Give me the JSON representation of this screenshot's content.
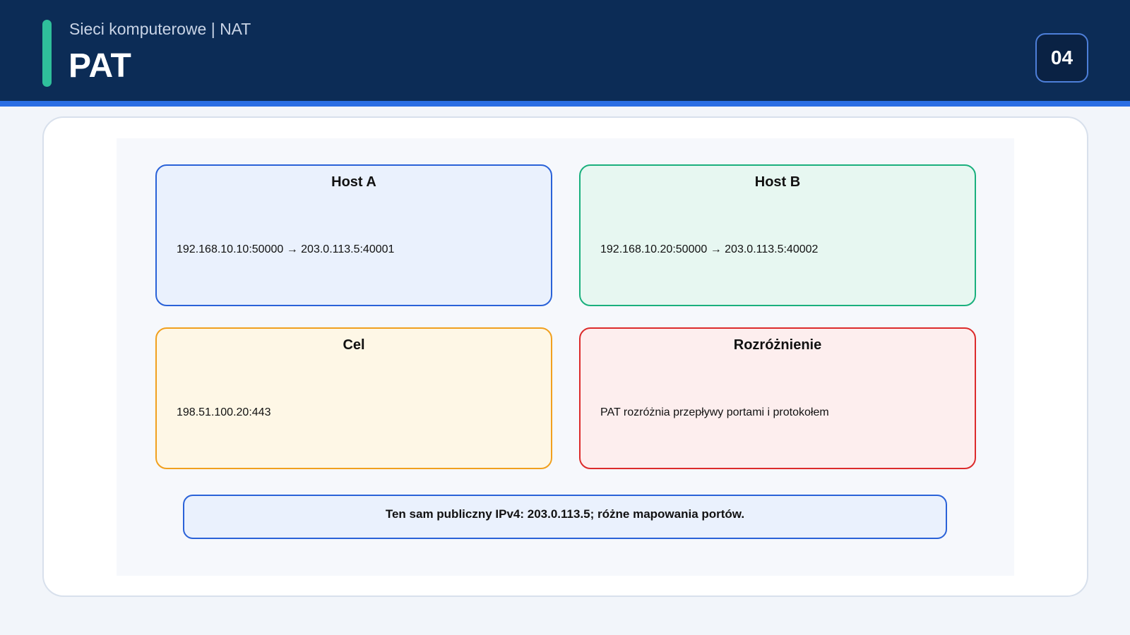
{
  "header": {
    "subtitle": "Sieci komputerowe | NAT",
    "title": "PAT",
    "slide_number": "04"
  },
  "diagram": {
    "nodes": [
      {
        "title": "Host A",
        "text": "192.168.10.10:50000 → 203.0.113.5:40001"
      },
      {
        "title": "Host B",
        "text": "192.168.10.20:50000 → 203.0.113.5:40002"
      },
      {
        "title": "Cel",
        "text": "198.51.100.20:443"
      },
      {
        "title": "Rozróżnienie",
        "text": "PAT rozróżnia przepływy portami i protokołem"
      }
    ],
    "summary": "Ten sam publiczny IPv4: 203.0.113.5; różne mapowania portów."
  }
}
